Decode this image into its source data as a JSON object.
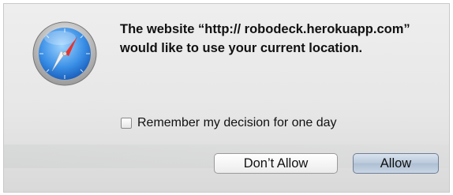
{
  "dialog": {
    "message": "The website “http:// robodeck.herokuapp.com” would like to use your current location.",
    "remember_label": "Remember my decision for one day",
    "remember_checked": false,
    "deny_label": "Don’t Allow",
    "allow_label": "Allow",
    "icon": "safari-compass-icon"
  },
  "colors": {
    "dialog_bg": "#e9e9e9",
    "allow_button": "#bfcde0"
  }
}
